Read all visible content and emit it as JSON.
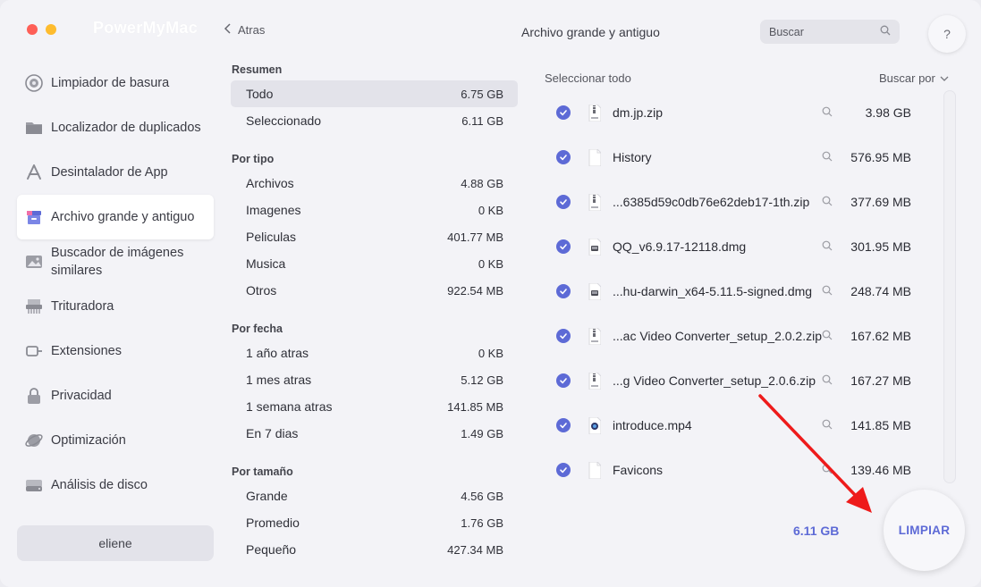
{
  "app": {
    "brand": "PowerMyMac"
  },
  "colors": {
    "accent": "#5d6ad6",
    "annotation_arrow": "#ee1b1b"
  },
  "sidebar": {
    "items": [
      {
        "label": "Limpiador de basura",
        "icon": "trash-cleaner-icon"
      },
      {
        "label": "Localizador de duplicados",
        "icon": "folder-icon"
      },
      {
        "label": "Desintalador de App",
        "icon": "app-store-icon"
      },
      {
        "label": "Archivo grande y antiguo",
        "icon": "archive-box-icon",
        "active": true
      },
      {
        "label": "Buscador de imágenes similares",
        "icon": "image-icon"
      },
      {
        "label": "Trituradora",
        "icon": "shredder-icon"
      },
      {
        "label": "Extensiones",
        "icon": "plug-icon"
      },
      {
        "label": "Privacidad",
        "icon": "lock-icon"
      },
      {
        "label": "Optimización",
        "icon": "satellite-icon"
      },
      {
        "label": "Análisis de disco",
        "icon": "disk-icon"
      }
    ],
    "user": "eliene"
  },
  "header": {
    "back": "Atras",
    "title": "Archivo grande y antiguo",
    "search_placeholder": "Buscar",
    "help": "?"
  },
  "summary": {
    "resumen": {
      "title": "Resumen",
      "rows": [
        {
          "label": "Todo",
          "value": "6.75 GB"
        },
        {
          "label": "Seleccionado",
          "value": "6.11 GB"
        }
      ]
    },
    "por_tipo": {
      "title": "Por tipo",
      "rows": [
        {
          "label": "Archivos",
          "value": "4.88 GB"
        },
        {
          "label": "Imagenes",
          "value": "0 KB"
        },
        {
          "label": "Peliculas",
          "value": "401.77 MB"
        },
        {
          "label": "Musica",
          "value": "0 KB"
        },
        {
          "label": "Otros",
          "value": "922.54 MB"
        }
      ]
    },
    "por_fecha": {
      "title": "Por fecha",
      "rows": [
        {
          "label": "1 año atras",
          "value": "0 KB"
        },
        {
          "label": "1 mes atras",
          "value": "5.12 GB"
        },
        {
          "label": "1 semana atras",
          "value": "141.85 MB"
        },
        {
          "label": "En 7 dias",
          "value": "1.49 GB"
        }
      ]
    },
    "por_tamano": {
      "title": "Por tamaño",
      "rows": [
        {
          "label": "Grande",
          "value": "4.56 GB"
        },
        {
          "label": "Promedio",
          "value": "1.76 GB"
        },
        {
          "label": "Pequeño",
          "value": "427.34 MB"
        }
      ]
    }
  },
  "files": {
    "select_all": "Seleccionar todo",
    "sort_by": "Buscar por",
    "items": [
      {
        "name": "dm.jp.zip",
        "size": "3.98 GB",
        "icon": "zip-file-icon"
      },
      {
        "name": "History",
        "size": "576.95 MB",
        "icon": "blank-file-icon"
      },
      {
        "name": "...6385d59c0db76e62deb17-1th.zip",
        "size": "377.69 MB",
        "icon": "zip-file-icon"
      },
      {
        "name": "QQ_v6.9.17-12118.dmg",
        "size": "301.95 MB",
        "icon": "dmg-file-icon"
      },
      {
        "name": "...hu-darwin_x64-5.11.5-signed.dmg",
        "size": "248.74 MB",
        "icon": "dmg-file-icon"
      },
      {
        "name": "...ac Video Converter_setup_2.0.2.zip",
        "size": "167.62 MB",
        "icon": "zip-file-icon"
      },
      {
        "name": "...g Video Converter_setup_2.0.6.zip",
        "size": "167.27 MB",
        "icon": "zip-file-icon"
      },
      {
        "name": "introduce.mp4",
        "size": "141.85 MB",
        "icon": "video-file-icon"
      },
      {
        "name": "Favicons",
        "size": "139.46 MB",
        "icon": "blank-file-icon"
      }
    ],
    "total_selected": "6.11 GB",
    "clean_button": "LIMPIAR"
  }
}
